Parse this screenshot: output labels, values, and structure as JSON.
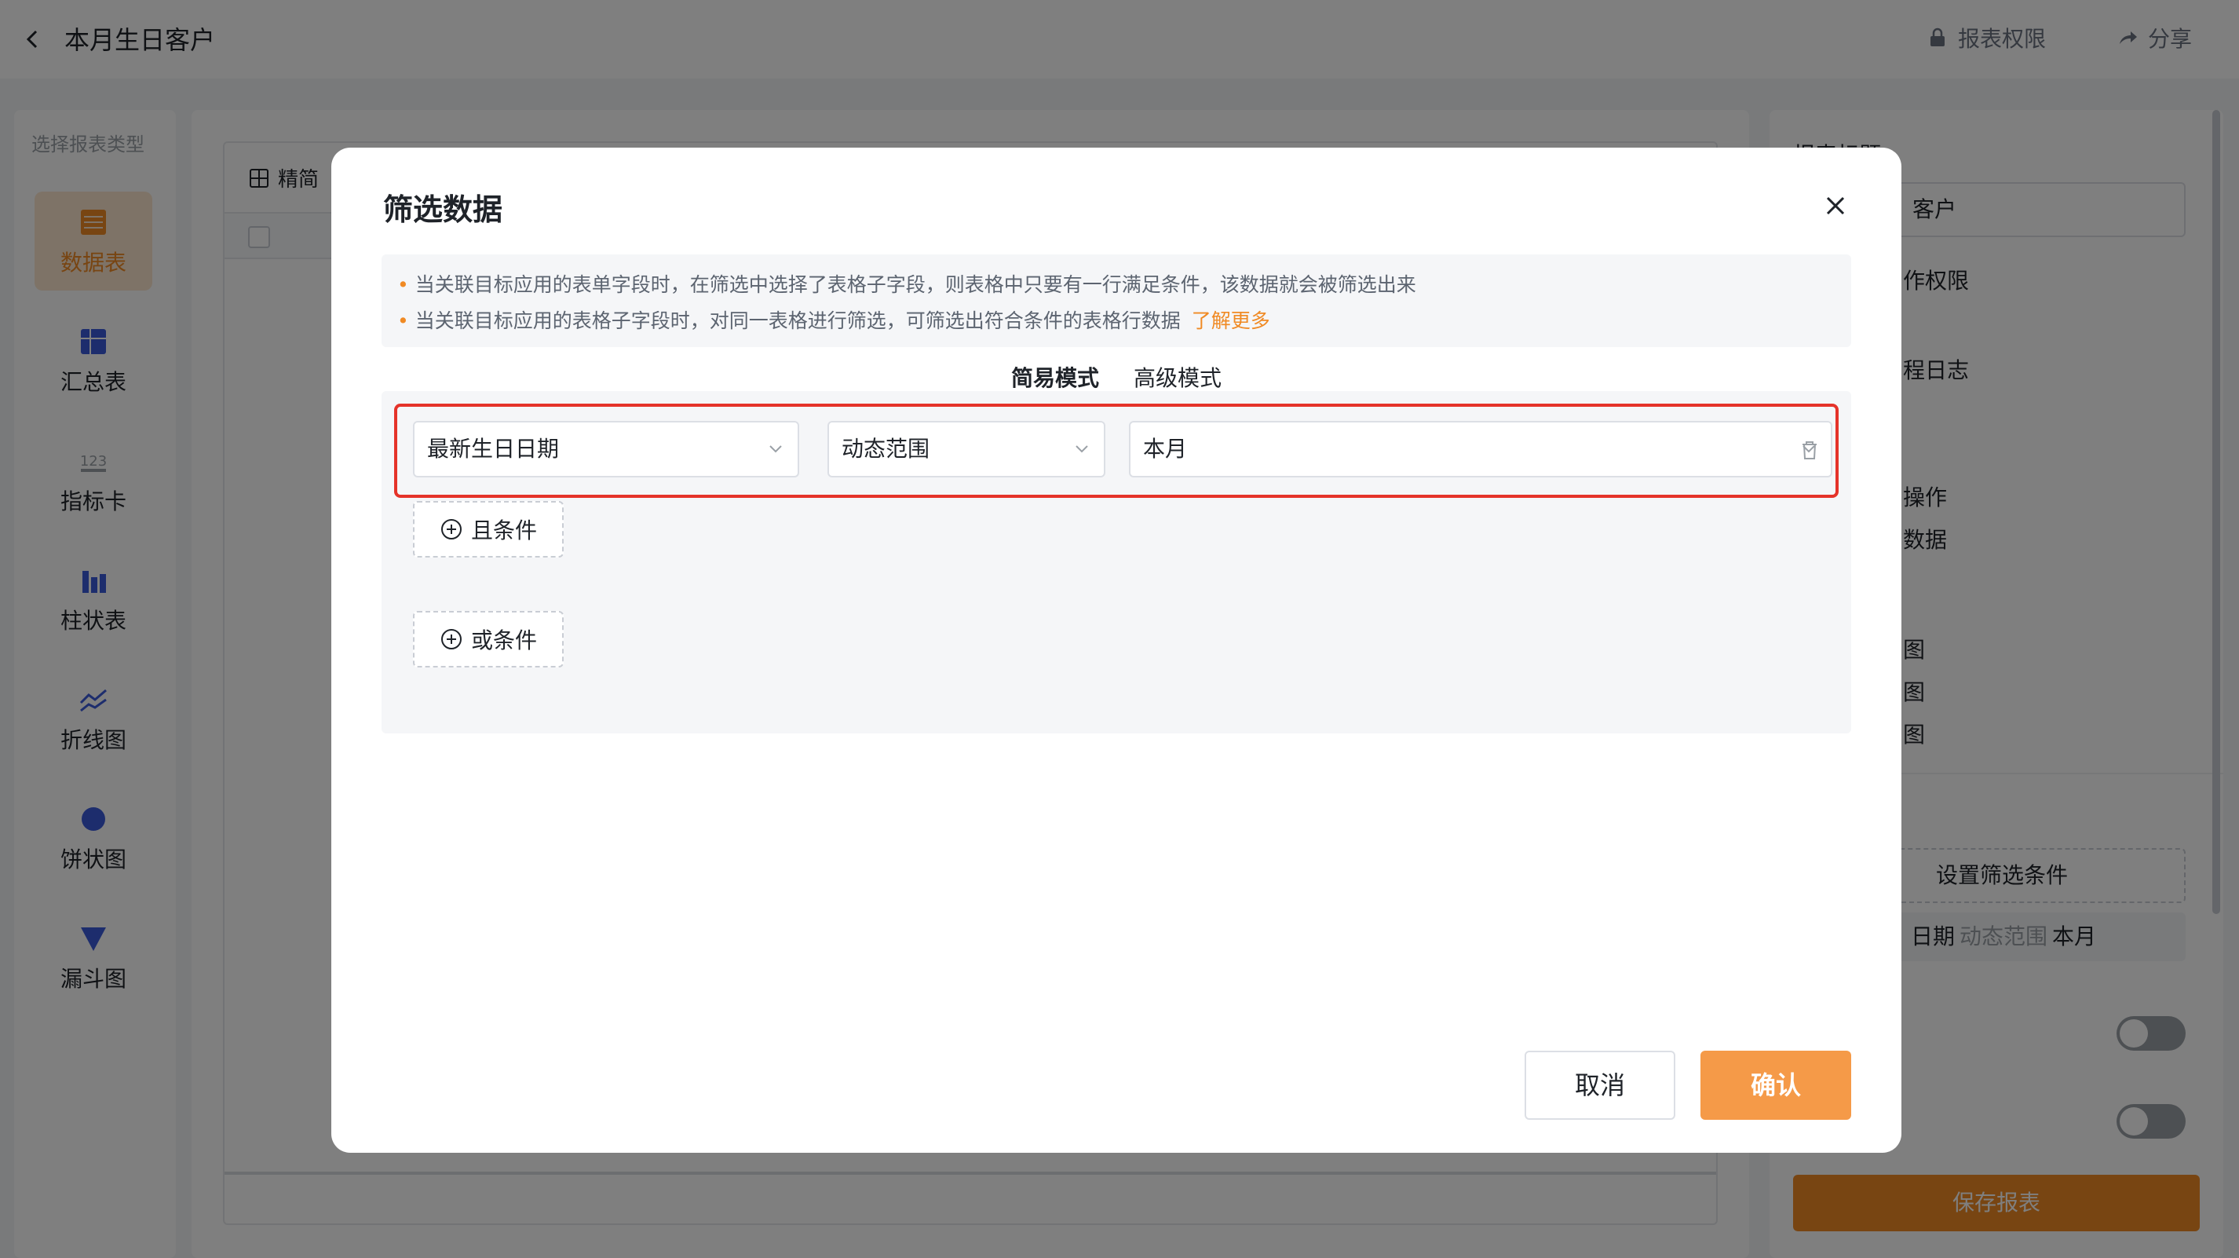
{
  "header": {
    "title": "本月生日客户",
    "permission_label": "报表权限",
    "share_label": "分享"
  },
  "left_panel": {
    "caption": "选择报表类型",
    "items": [
      {
        "label": "数据表",
        "icon": "table-icon",
        "active": true
      },
      {
        "label": "汇总表",
        "icon": "summary-table-icon",
        "active": false
      },
      {
        "label": "指标卡",
        "icon": "metric-card-icon",
        "active": false
      },
      {
        "label": "柱状表",
        "icon": "bar-chart-icon",
        "active": false
      },
      {
        "label": "折线图",
        "icon": "line-chart-icon",
        "active": false
      },
      {
        "label": "饼状图",
        "icon": "pie-chart-icon",
        "active": false
      },
      {
        "label": "漏斗图",
        "icon": "funnel-chart-icon",
        "active": false
      }
    ]
  },
  "center_panel": {
    "tab_label": "精简"
  },
  "right_panel": {
    "heading": "报表标题",
    "title_value": "客户",
    "lines": [
      "作权限",
      "程日志",
      "操作",
      "数据",
      "图",
      "图",
      "图"
    ],
    "set_filter_label": "设置筛选条件",
    "filter_summary": {
      "field": "日期",
      "operator": "动态范围",
      "value": "本月"
    },
    "save_label": "保存报表"
  },
  "modal": {
    "title": "筛选数据",
    "notices": [
      "当关联目标应用的表单字段时，在筛选中选择了表格子字段，则表格中只要有一行满足条件，该数据就会被筛选出来",
      "当关联目标应用的表格子字段时，对同一表格进行筛选，可筛选出符合条件的表格行数据"
    ],
    "learn_more": "了解更多",
    "modes": [
      {
        "label": "简易模式",
        "active": true
      },
      {
        "label": "高级模式",
        "active": false
      }
    ],
    "condition": {
      "field": "最新生日日期",
      "operator": "动态范围",
      "value": "本月"
    },
    "and_label": "且条件",
    "or_label": "或条件",
    "cancel_label": "取消",
    "confirm_label": "确认"
  },
  "colors": {
    "accent": "#f08a24",
    "highlight_border": "#e5332a",
    "overlay": "rgba(0,0,0,0.5)"
  }
}
